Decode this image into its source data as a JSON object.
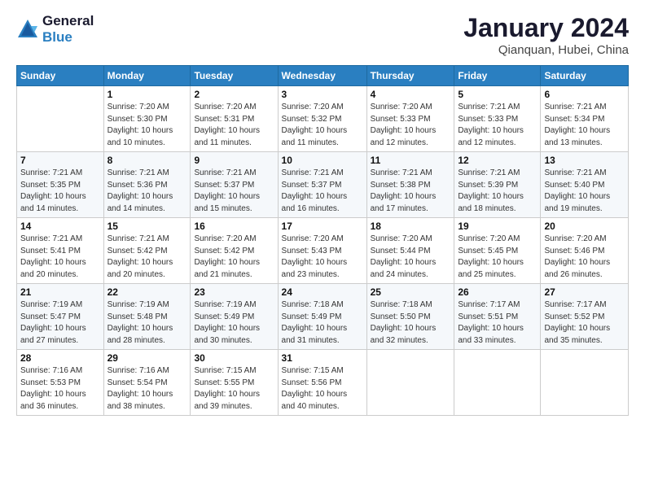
{
  "logo": {
    "line1": "General",
    "line2": "Blue"
  },
  "title": "January 2024",
  "location": "Qianquan, Hubei, China",
  "headers": [
    "Sunday",
    "Monday",
    "Tuesday",
    "Wednesday",
    "Thursday",
    "Friday",
    "Saturday"
  ],
  "weeks": [
    [
      {
        "day": "",
        "info": ""
      },
      {
        "day": "1",
        "info": "Sunrise: 7:20 AM\nSunset: 5:30 PM\nDaylight: 10 hours\nand 10 minutes."
      },
      {
        "day": "2",
        "info": "Sunrise: 7:20 AM\nSunset: 5:31 PM\nDaylight: 10 hours\nand 11 minutes."
      },
      {
        "day": "3",
        "info": "Sunrise: 7:20 AM\nSunset: 5:32 PM\nDaylight: 10 hours\nand 11 minutes."
      },
      {
        "day": "4",
        "info": "Sunrise: 7:20 AM\nSunset: 5:33 PM\nDaylight: 10 hours\nand 12 minutes."
      },
      {
        "day": "5",
        "info": "Sunrise: 7:21 AM\nSunset: 5:33 PM\nDaylight: 10 hours\nand 12 minutes."
      },
      {
        "day": "6",
        "info": "Sunrise: 7:21 AM\nSunset: 5:34 PM\nDaylight: 10 hours\nand 13 minutes."
      }
    ],
    [
      {
        "day": "7",
        "info": "Sunrise: 7:21 AM\nSunset: 5:35 PM\nDaylight: 10 hours\nand 14 minutes."
      },
      {
        "day": "8",
        "info": "Sunrise: 7:21 AM\nSunset: 5:36 PM\nDaylight: 10 hours\nand 14 minutes."
      },
      {
        "day": "9",
        "info": "Sunrise: 7:21 AM\nSunset: 5:37 PM\nDaylight: 10 hours\nand 15 minutes."
      },
      {
        "day": "10",
        "info": "Sunrise: 7:21 AM\nSunset: 5:37 PM\nDaylight: 10 hours\nand 16 minutes."
      },
      {
        "day": "11",
        "info": "Sunrise: 7:21 AM\nSunset: 5:38 PM\nDaylight: 10 hours\nand 17 minutes."
      },
      {
        "day": "12",
        "info": "Sunrise: 7:21 AM\nSunset: 5:39 PM\nDaylight: 10 hours\nand 18 minutes."
      },
      {
        "day": "13",
        "info": "Sunrise: 7:21 AM\nSunset: 5:40 PM\nDaylight: 10 hours\nand 19 minutes."
      }
    ],
    [
      {
        "day": "14",
        "info": "Sunrise: 7:21 AM\nSunset: 5:41 PM\nDaylight: 10 hours\nand 20 minutes."
      },
      {
        "day": "15",
        "info": "Sunrise: 7:21 AM\nSunset: 5:42 PM\nDaylight: 10 hours\nand 20 minutes."
      },
      {
        "day": "16",
        "info": "Sunrise: 7:20 AM\nSunset: 5:42 PM\nDaylight: 10 hours\nand 21 minutes."
      },
      {
        "day": "17",
        "info": "Sunrise: 7:20 AM\nSunset: 5:43 PM\nDaylight: 10 hours\nand 23 minutes."
      },
      {
        "day": "18",
        "info": "Sunrise: 7:20 AM\nSunset: 5:44 PM\nDaylight: 10 hours\nand 24 minutes."
      },
      {
        "day": "19",
        "info": "Sunrise: 7:20 AM\nSunset: 5:45 PM\nDaylight: 10 hours\nand 25 minutes."
      },
      {
        "day": "20",
        "info": "Sunrise: 7:20 AM\nSunset: 5:46 PM\nDaylight: 10 hours\nand 26 minutes."
      }
    ],
    [
      {
        "day": "21",
        "info": "Sunrise: 7:19 AM\nSunset: 5:47 PM\nDaylight: 10 hours\nand 27 minutes."
      },
      {
        "day": "22",
        "info": "Sunrise: 7:19 AM\nSunset: 5:48 PM\nDaylight: 10 hours\nand 28 minutes."
      },
      {
        "day": "23",
        "info": "Sunrise: 7:19 AM\nSunset: 5:49 PM\nDaylight: 10 hours\nand 30 minutes."
      },
      {
        "day": "24",
        "info": "Sunrise: 7:18 AM\nSunset: 5:49 PM\nDaylight: 10 hours\nand 31 minutes."
      },
      {
        "day": "25",
        "info": "Sunrise: 7:18 AM\nSunset: 5:50 PM\nDaylight: 10 hours\nand 32 minutes."
      },
      {
        "day": "26",
        "info": "Sunrise: 7:17 AM\nSunset: 5:51 PM\nDaylight: 10 hours\nand 33 minutes."
      },
      {
        "day": "27",
        "info": "Sunrise: 7:17 AM\nSunset: 5:52 PM\nDaylight: 10 hours\nand 35 minutes."
      }
    ],
    [
      {
        "day": "28",
        "info": "Sunrise: 7:16 AM\nSunset: 5:53 PM\nDaylight: 10 hours\nand 36 minutes."
      },
      {
        "day": "29",
        "info": "Sunrise: 7:16 AM\nSunset: 5:54 PM\nDaylight: 10 hours\nand 38 minutes."
      },
      {
        "day": "30",
        "info": "Sunrise: 7:15 AM\nSunset: 5:55 PM\nDaylight: 10 hours\nand 39 minutes."
      },
      {
        "day": "31",
        "info": "Sunrise: 7:15 AM\nSunset: 5:56 PM\nDaylight: 10 hours\nand 40 minutes."
      },
      {
        "day": "",
        "info": ""
      },
      {
        "day": "",
        "info": ""
      },
      {
        "day": "",
        "info": ""
      }
    ]
  ]
}
